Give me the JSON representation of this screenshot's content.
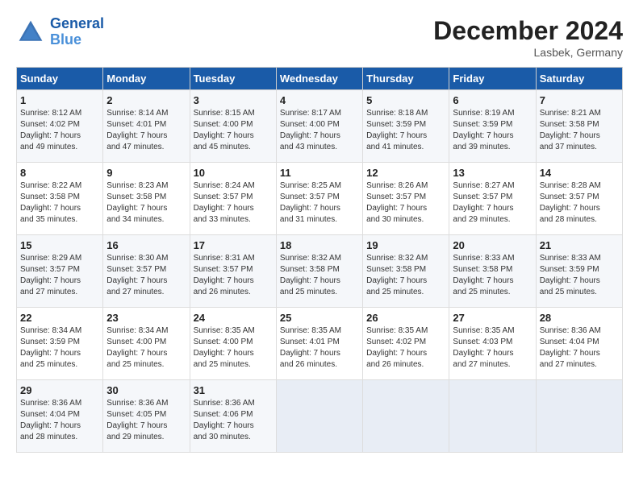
{
  "header": {
    "logo_line1": "General",
    "logo_line2": "Blue",
    "month": "December 2024",
    "location": "Lasbek, Germany"
  },
  "weekdays": [
    "Sunday",
    "Monday",
    "Tuesday",
    "Wednesday",
    "Thursday",
    "Friday",
    "Saturday"
  ],
  "weeks": [
    [
      {
        "day": "1",
        "detail": "Sunrise: 8:12 AM\nSunset: 4:02 PM\nDaylight: 7 hours\nand 49 minutes."
      },
      {
        "day": "2",
        "detail": "Sunrise: 8:14 AM\nSunset: 4:01 PM\nDaylight: 7 hours\nand 47 minutes."
      },
      {
        "day": "3",
        "detail": "Sunrise: 8:15 AM\nSunset: 4:00 PM\nDaylight: 7 hours\nand 45 minutes."
      },
      {
        "day": "4",
        "detail": "Sunrise: 8:17 AM\nSunset: 4:00 PM\nDaylight: 7 hours\nand 43 minutes."
      },
      {
        "day": "5",
        "detail": "Sunrise: 8:18 AM\nSunset: 3:59 PM\nDaylight: 7 hours\nand 41 minutes."
      },
      {
        "day": "6",
        "detail": "Sunrise: 8:19 AM\nSunset: 3:59 PM\nDaylight: 7 hours\nand 39 minutes."
      },
      {
        "day": "7",
        "detail": "Sunrise: 8:21 AM\nSunset: 3:58 PM\nDaylight: 7 hours\nand 37 minutes."
      }
    ],
    [
      {
        "day": "8",
        "detail": "Sunrise: 8:22 AM\nSunset: 3:58 PM\nDaylight: 7 hours\nand 35 minutes."
      },
      {
        "day": "9",
        "detail": "Sunrise: 8:23 AM\nSunset: 3:58 PM\nDaylight: 7 hours\nand 34 minutes."
      },
      {
        "day": "10",
        "detail": "Sunrise: 8:24 AM\nSunset: 3:57 PM\nDaylight: 7 hours\nand 33 minutes."
      },
      {
        "day": "11",
        "detail": "Sunrise: 8:25 AM\nSunset: 3:57 PM\nDaylight: 7 hours\nand 31 minutes."
      },
      {
        "day": "12",
        "detail": "Sunrise: 8:26 AM\nSunset: 3:57 PM\nDaylight: 7 hours\nand 30 minutes."
      },
      {
        "day": "13",
        "detail": "Sunrise: 8:27 AM\nSunset: 3:57 PM\nDaylight: 7 hours\nand 29 minutes."
      },
      {
        "day": "14",
        "detail": "Sunrise: 8:28 AM\nSunset: 3:57 PM\nDaylight: 7 hours\nand 28 minutes."
      }
    ],
    [
      {
        "day": "15",
        "detail": "Sunrise: 8:29 AM\nSunset: 3:57 PM\nDaylight: 7 hours\nand 27 minutes."
      },
      {
        "day": "16",
        "detail": "Sunrise: 8:30 AM\nSunset: 3:57 PM\nDaylight: 7 hours\nand 27 minutes."
      },
      {
        "day": "17",
        "detail": "Sunrise: 8:31 AM\nSunset: 3:57 PM\nDaylight: 7 hours\nand 26 minutes."
      },
      {
        "day": "18",
        "detail": "Sunrise: 8:32 AM\nSunset: 3:58 PM\nDaylight: 7 hours\nand 25 minutes."
      },
      {
        "day": "19",
        "detail": "Sunrise: 8:32 AM\nSunset: 3:58 PM\nDaylight: 7 hours\nand 25 minutes."
      },
      {
        "day": "20",
        "detail": "Sunrise: 8:33 AM\nSunset: 3:58 PM\nDaylight: 7 hours\nand 25 minutes."
      },
      {
        "day": "21",
        "detail": "Sunrise: 8:33 AM\nSunset: 3:59 PM\nDaylight: 7 hours\nand 25 minutes."
      }
    ],
    [
      {
        "day": "22",
        "detail": "Sunrise: 8:34 AM\nSunset: 3:59 PM\nDaylight: 7 hours\nand 25 minutes."
      },
      {
        "day": "23",
        "detail": "Sunrise: 8:34 AM\nSunset: 4:00 PM\nDaylight: 7 hours\nand 25 minutes."
      },
      {
        "day": "24",
        "detail": "Sunrise: 8:35 AM\nSunset: 4:00 PM\nDaylight: 7 hours\nand 25 minutes."
      },
      {
        "day": "25",
        "detail": "Sunrise: 8:35 AM\nSunset: 4:01 PM\nDaylight: 7 hours\nand 26 minutes."
      },
      {
        "day": "26",
        "detail": "Sunrise: 8:35 AM\nSunset: 4:02 PM\nDaylight: 7 hours\nand 26 minutes."
      },
      {
        "day": "27",
        "detail": "Sunrise: 8:35 AM\nSunset: 4:03 PM\nDaylight: 7 hours\nand 27 minutes."
      },
      {
        "day": "28",
        "detail": "Sunrise: 8:36 AM\nSunset: 4:04 PM\nDaylight: 7 hours\nand 27 minutes."
      }
    ],
    [
      {
        "day": "29",
        "detail": "Sunrise: 8:36 AM\nSunset: 4:04 PM\nDaylight: 7 hours\nand 28 minutes."
      },
      {
        "day": "30",
        "detail": "Sunrise: 8:36 AM\nSunset: 4:05 PM\nDaylight: 7 hours\nand 29 minutes."
      },
      {
        "day": "31",
        "detail": "Sunrise: 8:36 AM\nSunset: 4:06 PM\nDaylight: 7 hours\nand 30 minutes."
      },
      {
        "day": "",
        "detail": ""
      },
      {
        "day": "",
        "detail": ""
      },
      {
        "day": "",
        "detail": ""
      },
      {
        "day": "",
        "detail": ""
      }
    ]
  ]
}
